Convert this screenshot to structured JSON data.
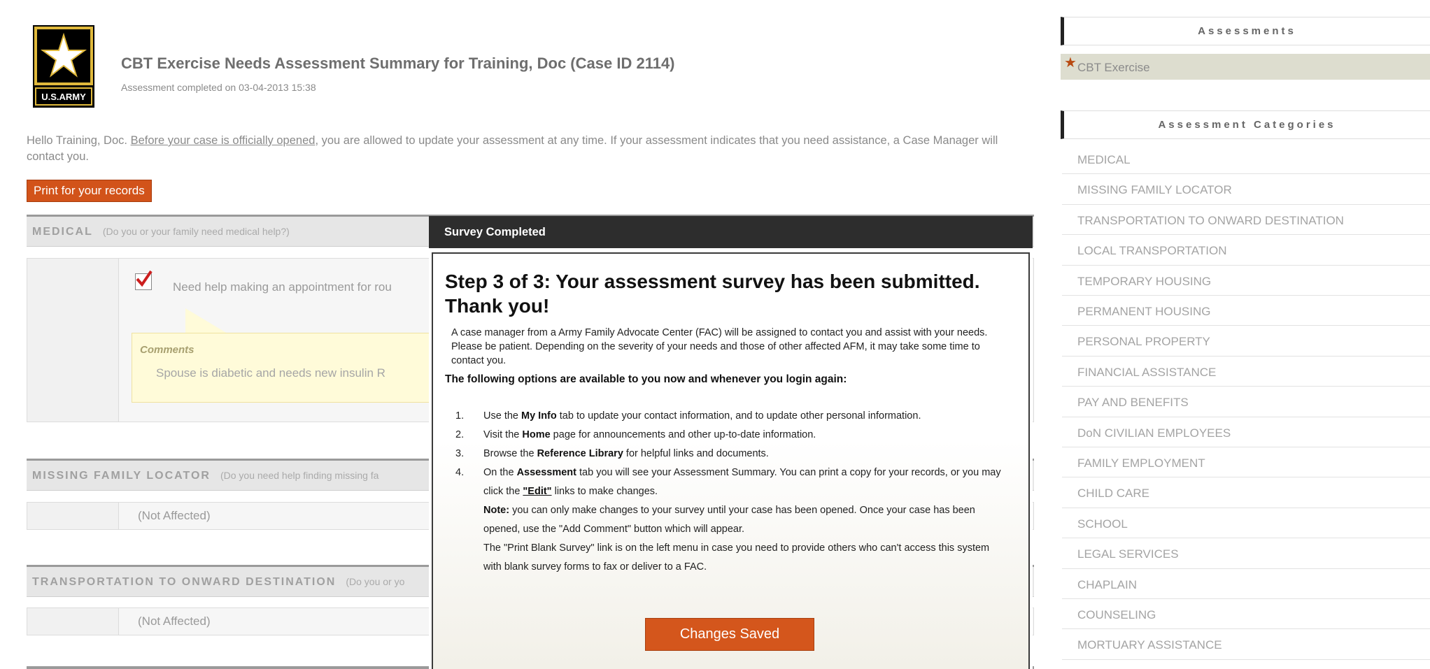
{
  "header": {
    "logo_text": "U.S.ARMY",
    "title": "CBT Exercise Needs Assessment Summary for Training, Doc (Case ID 2114)",
    "subtitle": "Assessment completed on 03-04-2013 15:38"
  },
  "intro": {
    "part1": "Hello Training, Doc. ",
    "link": "Before your case is officially opened",
    "part2": ", you are allowed to update your assessment at any time.  If your assessment indicates that you need assistance, a Case Manager will contact you."
  },
  "print_button": "Print for your records",
  "sections": {
    "medical": {
      "name": "MEDICAL",
      "question": "(Do you or your family need medical help?)"
    },
    "missing": {
      "name": "MISSING FAMILY LOCATOR",
      "question": "(Do you need help finding missing fa"
    },
    "transport": {
      "name": "TRANSPORTATION TO ONWARD DESTINATION",
      "question": "(Do you or yo"
    }
  },
  "medical_item": {
    "checkbox_label": "Need help making an appointment for rou",
    "comments_title": "Comments",
    "comment_text": "Spouse is diabetic and needs new insulin R"
  },
  "not_affected": "(Not Affected)",
  "modal": {
    "title": "Survey Completed",
    "step": "Step 3 of 3: Your assessment survey has been submitted. Thank you!",
    "paragraph": "A case manager from a Army Family Advocate Center (FAC) will be assigned to contact you and assist with your needs. Please be patient. Depending on the severity of your needs and those of other affected AFM, it may take some time to contact you.",
    "options_heading": "The following options are available to you now and whenever you login again:",
    "list": [
      {
        "num": "1.",
        "pre": "Use the ",
        "bold": "My Info",
        "post": " tab to update your contact information, and to update other personal information."
      },
      {
        "num": "2.",
        "pre": "Visit the ",
        "bold": "Home",
        "post": " page for announcements and other up-to-date information."
      },
      {
        "num": "3.",
        "pre": "Browse the ",
        "bold": "Reference Library",
        "post": " for helpful links and documents."
      },
      {
        "num": "4.",
        "pre": "On the ",
        "bold": "Assessment",
        "post": " tab you will see your Assessment Summary. You can print a copy for your records, or you may click the ",
        "edit_link": "\"Edit\"",
        "post2": " links to make changes."
      }
    ],
    "note_label": "Note:",
    "note_text": " you can only make changes to your survey until your case has been opened. Once your case has been opened, use the \"Add Comment\" button which will appear.",
    "print_blank_text": "The \"Print Blank Survey\" link is on the left menu in case you need to provide others who can't access this system with blank survey forms to fax or deliver to a FAC.",
    "button": "Changes Saved"
  },
  "sidebar": {
    "assessments_title": "Assessments",
    "assessment_item": "CBT Exercise",
    "categories_title": "Assessment Categories",
    "categories": [
      "MEDICAL",
      "MISSING FAMILY LOCATOR",
      "TRANSPORTATION TO ONWARD DESTINATION",
      "LOCAL TRANSPORTATION",
      "TEMPORARY HOUSING",
      "PERMANENT HOUSING",
      "PERSONAL PROPERTY",
      "FINANCIAL ASSISTANCE",
      "PAY AND BENEFITS",
      "DoN CIVILIAN EMPLOYEES",
      "FAMILY EMPLOYMENT",
      "CHILD CARE",
      "SCHOOL",
      "LEGAL SERVICES",
      "CHAPLAIN",
      "COUNSELING",
      "MORTUARY ASSISTANCE"
    ]
  },
  "colors": {
    "accent_orange": "#d2531a",
    "modal_header": "#2d2d2d",
    "logo_gold": "#e0b93c"
  }
}
